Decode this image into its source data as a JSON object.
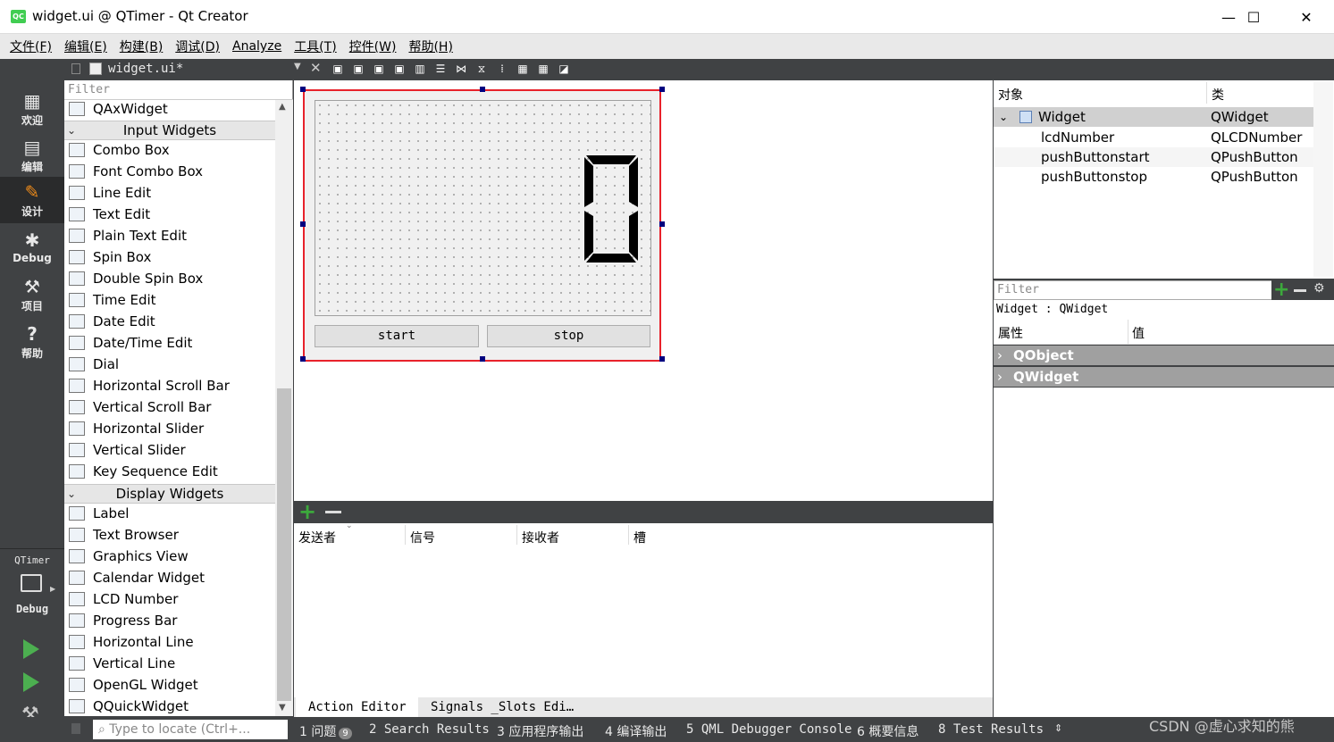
{
  "window": {
    "title": "widget.ui @ QTimer - Qt Creator",
    "icon_text": "QC",
    "controls": [
      "—",
      "☐",
      "✕"
    ]
  },
  "menubar": [
    "文件(F)",
    "编辑(E)",
    "构建(B)",
    "调试(D)",
    "Analyze",
    "工具(T)",
    "控件(W)",
    "帮助(H)"
  ],
  "file_tab": {
    "name": "widget.ui*"
  },
  "modebar": {
    "modes": [
      {
        "label": "欢迎",
        "icon": "grid-icon"
      },
      {
        "label": "编辑",
        "icon": "document-icon"
      },
      {
        "label": "设计",
        "icon": "pencil-icon"
      },
      {
        "label": "Debug",
        "icon": "bug-icon"
      },
      {
        "label": "项目",
        "icon": "wrench-icon"
      },
      {
        "label": "帮助",
        "icon": "help-icon"
      }
    ],
    "project": "QTimer",
    "target": "Debug"
  },
  "widgetbox": {
    "filter_placeholder": "Filter",
    "top_item": "QAxWidget",
    "input_category": "Input Widgets",
    "input_items": [
      "Combo Box",
      "Font Combo Box",
      "Line Edit",
      "Text Edit",
      "Plain Text Edit",
      "Spin Box",
      "Double Spin Box",
      "Time Edit",
      "Date Edit",
      "Date/Time Edit",
      "Dial",
      "Horizontal Scroll Bar",
      "Vertical Scroll Bar",
      "Horizontal Slider",
      "Vertical Slider",
      "Key Sequence Edit"
    ],
    "display_category": "Display Widgets",
    "display_items": [
      "Label",
      "Text Browser",
      "Graphics View",
      "Calendar Widget",
      "LCD Number",
      "Progress Bar",
      "Horizontal Line",
      "Vertical Line",
      "OpenGL Widget",
      "QQuickWidget"
    ]
  },
  "form": {
    "lcd_value": "0",
    "start_label": "start",
    "stop_label": "stop"
  },
  "signals": {
    "headers": [
      "发送者",
      "信号",
      "接收者",
      "槽"
    ],
    "tabs": [
      "Action Editor",
      "Signals _Slots Edi…"
    ]
  },
  "object_inspector": {
    "headers": [
      "对象",
      "类"
    ],
    "rows": [
      {
        "object": "Widget",
        "class": "QWidget"
      },
      {
        "object": "lcdNumber",
        "class": "QLCDNumber"
      },
      {
        "object": "pushButtonstart",
        "class": "QPushButton"
      },
      {
        "object": "pushButtonstop",
        "class": "QPushButton"
      }
    ]
  },
  "property_editor": {
    "filter_placeholder": "Filter",
    "context": "Widget : QWidget",
    "headers": [
      "属性",
      "值"
    ],
    "groups": [
      "QObject",
      "QWidget"
    ]
  },
  "statusbar": {
    "locate_placeholder": "Type to locate (Ctrl+...",
    "problems_label": "1 问题",
    "problems_count": "9",
    "panes": [
      "2 Search Results",
      "3 应用程序输出",
      "4 编译输出",
      "5 QML Debugger Console",
      "6 概要信息",
      "8 Test Results"
    ],
    "watermark": "CSDN @虚心求知的熊"
  },
  "colors": {
    "selection": "#e8222b",
    "handle": "#00007f",
    "add": "#3ca93c",
    "dark": "#404244"
  }
}
